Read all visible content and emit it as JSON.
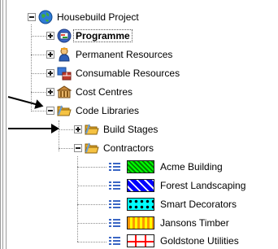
{
  "tree": {
    "root": {
      "label": "Housebuild Project",
      "icon": "globe-icon"
    },
    "programme": {
      "label": "Programme",
      "icon": "programme-icon"
    },
    "permanent": {
      "label": "Permanent Resources",
      "icon": "person-icon"
    },
    "consumable": {
      "label": "Consumable Resources",
      "icon": "bricks-icon"
    },
    "cost": {
      "label": "Cost Centres",
      "icon": "building-icon"
    },
    "codelib": {
      "label": "Code Libraries",
      "icon": "folder-open-icon"
    },
    "buildstages": {
      "label": "Build Stages",
      "icon": "folder-open-icon"
    },
    "contractors": {
      "label": "Contractors",
      "icon": "folder-open-icon"
    },
    "contractor_items": [
      {
        "label": "Acme Building",
        "swatch": "green-hatch"
      },
      {
        "label": "Forest Landscaping",
        "swatch": "blue-zigzag"
      },
      {
        "label": "Smart Decorators",
        "swatch": "cyan-dots"
      },
      {
        "label": "Jansons Timber",
        "swatch": "yellow-stripes"
      },
      {
        "label": "Goldstone Utilities",
        "swatch": "red-grid"
      }
    ]
  },
  "colors": {
    "accent_folder": "#f5c242",
    "globe": "#2f7bd6",
    "programme": "#3a66c4"
  }
}
